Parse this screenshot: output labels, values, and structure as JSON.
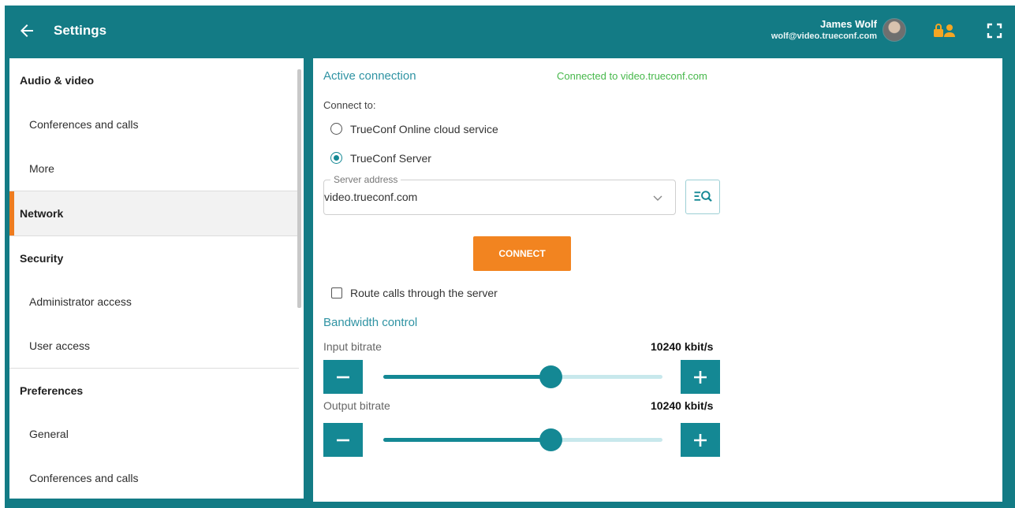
{
  "header": {
    "title": "Settings",
    "user_name": "James Wolf",
    "user_email": "wolf@video.trueconf.com"
  },
  "sidebar": {
    "items": [
      {
        "label": "Audio & video"
      },
      {
        "label": "Conferences and calls"
      },
      {
        "label": "More"
      },
      {
        "label": "Network"
      },
      {
        "label": "Security"
      },
      {
        "label": "Administrator access"
      },
      {
        "label": "User access"
      },
      {
        "label": "Preferences"
      },
      {
        "label": "General"
      },
      {
        "label": "Conferences and calls"
      }
    ]
  },
  "main": {
    "active_connection_title": "Active connection",
    "status": "Connected to video.trueconf.com",
    "connect_to_label": "Connect to:",
    "option_cloud": "TrueConf Online cloud service",
    "option_server": "TrueConf Server",
    "server_address_label": "Server address",
    "server_address_value": "video.trueconf.com",
    "connect_button": "CONNECT",
    "route_calls_label": "Route calls through the server",
    "bandwidth_title": "Bandwidth control",
    "input_bitrate_label": "Input bitrate",
    "input_bitrate_value": "10240 kbit/s",
    "input_bitrate_level": 0.6,
    "output_bitrate_label": "Output bitrate",
    "output_bitrate_value": "10240 kbit/s",
    "output_bitrate_level": 0.6
  },
  "colors": {
    "header_bg": "#137b85",
    "accent": "#148894",
    "orange": "#f28420",
    "connected_green": "#47b84b"
  }
}
